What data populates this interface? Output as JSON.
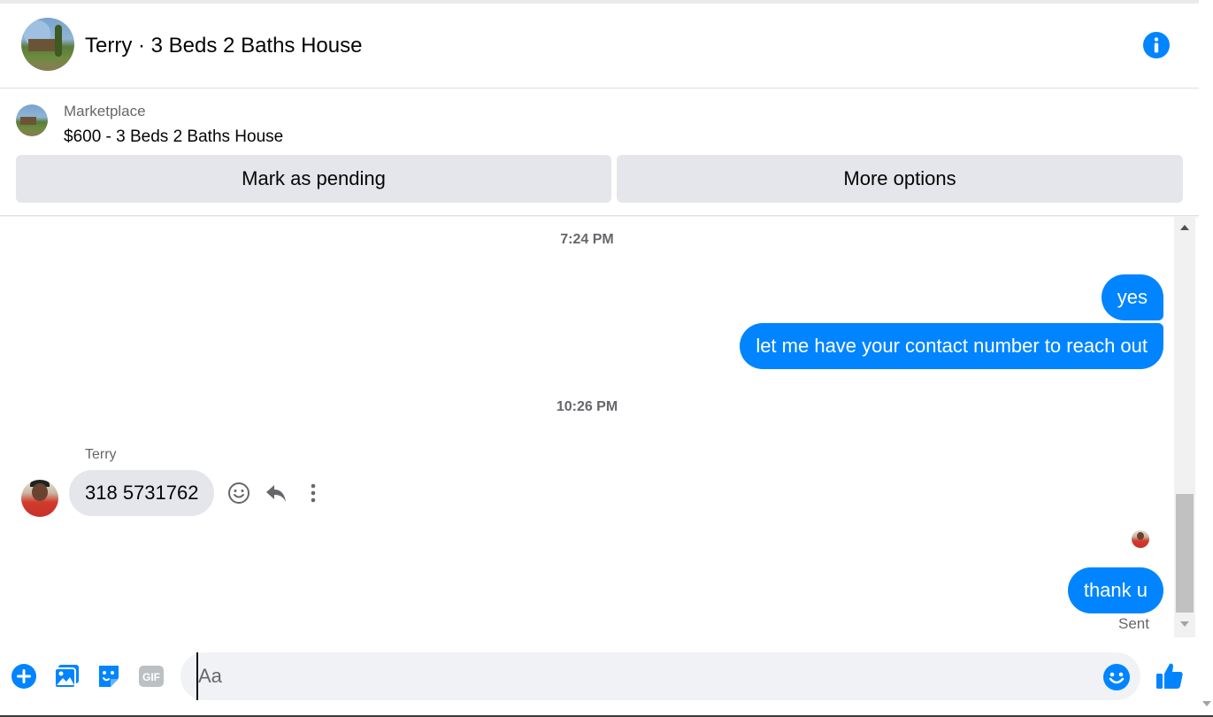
{
  "header": {
    "title": "Terry · 3 Beds 2 Baths House",
    "accent_color": "#0084ff"
  },
  "marketplace": {
    "label": "Marketplace",
    "listing": "$600 - 3 Beds 2 Baths House",
    "mark_pending_label": "Mark as pending",
    "more_options_label": "More options"
  },
  "conversation": {
    "timestamps": [
      "7:24 PM",
      "10:26 PM"
    ],
    "outgoing_1": [
      "yes",
      "let me have your contact number to reach out"
    ],
    "sender_name": "Terry",
    "incoming": "318 5731762",
    "outgoing_2": "thank u",
    "status": "Sent"
  },
  "composer": {
    "placeholder": "Aa",
    "value": ""
  },
  "icons": {
    "info": "info-icon",
    "plus": "plus-icon",
    "image": "image-icon",
    "sticker": "sticker-icon",
    "gif": "gif-icon",
    "emoji": "emoji-icon",
    "like": "thumbs-up-icon",
    "react": "smile-icon",
    "reply": "reply-icon",
    "more": "more-vertical-icon"
  }
}
